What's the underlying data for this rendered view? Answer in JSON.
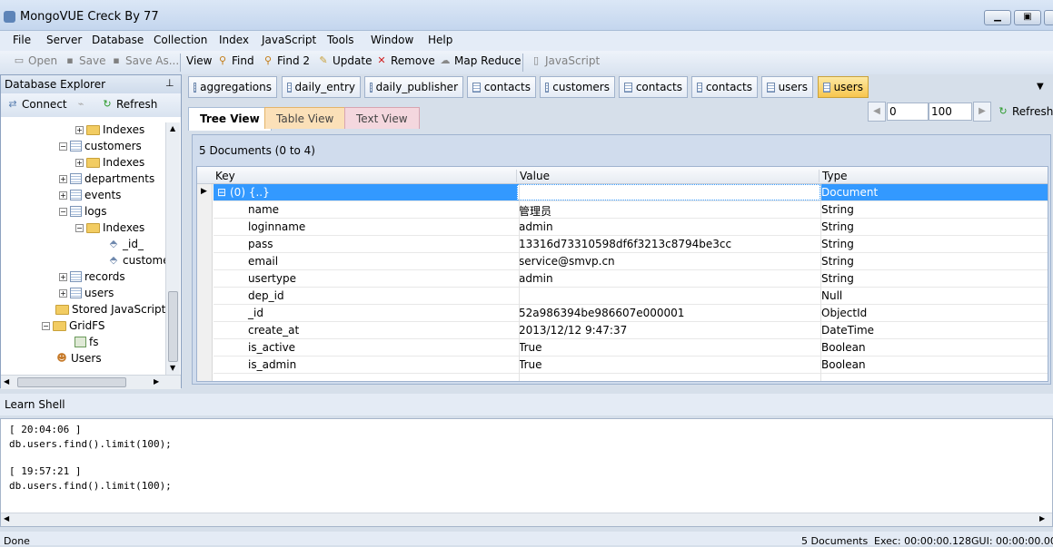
{
  "app": {
    "title": "MongoVUE Creck By 77"
  },
  "menu": [
    "File",
    "Server",
    "Database",
    "Collection",
    "Index",
    "JavaScript",
    "Tools",
    "Window",
    "Help"
  ],
  "toolbar": {
    "open": "Open",
    "save": "Save",
    "save_as": "Save As...",
    "view": "View",
    "find": "Find",
    "find2": "Find 2",
    "update": "Update",
    "remove": "Remove",
    "map_reduce": "Map Reduce",
    "javascript": "JavaScript"
  },
  "explorer": {
    "title": "Database Explorer",
    "connect": "Connect",
    "refresh": "Refresh",
    "items": [
      {
        "label": "Indexes",
        "type": "folder"
      },
      {
        "label": "customers",
        "type": "collection"
      },
      {
        "label": "Indexes",
        "type": "folder"
      },
      {
        "label": "departments",
        "type": "collection"
      },
      {
        "label": "events",
        "type": "collection"
      },
      {
        "label": "logs",
        "type": "collection"
      },
      {
        "label": "Indexes",
        "type": "folder"
      },
      {
        "label": "_id_",
        "type": "index"
      },
      {
        "label": "custome",
        "type": "index"
      },
      {
        "label": "records",
        "type": "collection"
      },
      {
        "label": "users",
        "type": "collection"
      },
      {
        "label": "Stored JavaScript",
        "type": "folder"
      },
      {
        "label": "GridFS",
        "type": "folder"
      },
      {
        "label": "fs",
        "type": "file"
      },
      {
        "label": "Users",
        "type": "user"
      }
    ]
  },
  "tabs": [
    "aggregations",
    "daily_entry",
    "daily_publisher",
    "contacts",
    "customers",
    "contacts",
    "contacts",
    "users",
    "users"
  ],
  "paging": {
    "skip": "0",
    "limit": "100",
    "refresh": "Refresh"
  },
  "views": {
    "tree": "Tree View",
    "table": "Table View",
    "text": "Text View"
  },
  "doc_count": "5 Documents (0 to 4)",
  "grid": {
    "headers": [
      "Key",
      "Value",
      "Type"
    ],
    "rows": [
      {
        "key": "(0) {..}",
        "value": "",
        "type": "Document"
      },
      {
        "key": "name",
        "value": "管理员",
        "type": "String"
      },
      {
        "key": "loginname",
        "value": "admin",
        "type": "String"
      },
      {
        "key": "pass",
        "value": "13316d73310598df6f3213c8794be3cc",
        "type": "String"
      },
      {
        "key": "email",
        "value": "service@smvp.cn",
        "type": "String"
      },
      {
        "key": "usertype",
        "value": "admin",
        "type": "String"
      },
      {
        "key": "dep_id",
        "value": "",
        "type": "Null"
      },
      {
        "key": "_id",
        "value": "52a986394be986607e000001",
        "type": "ObjectId"
      },
      {
        "key": "create_at",
        "value": "2013/12/12 9:47:37",
        "type": "DateTime"
      },
      {
        "key": "is_active",
        "value": "True",
        "type": "Boolean"
      },
      {
        "key": "is_admin",
        "value": "True",
        "type": "Boolean"
      }
    ]
  },
  "shell": {
    "title": "Learn Shell",
    "lines": [
      "[ 20:04:06 ]",
      "db.users.find().limit(100);",
      "",
      "[ 19:57:21 ]",
      "db.users.find().limit(100);"
    ]
  },
  "status": {
    "left": "Done",
    "docs": "5 Documents",
    "exec": "Exec: 00:00:00.128",
    "gui": "GUI: 00:00:00.007"
  }
}
